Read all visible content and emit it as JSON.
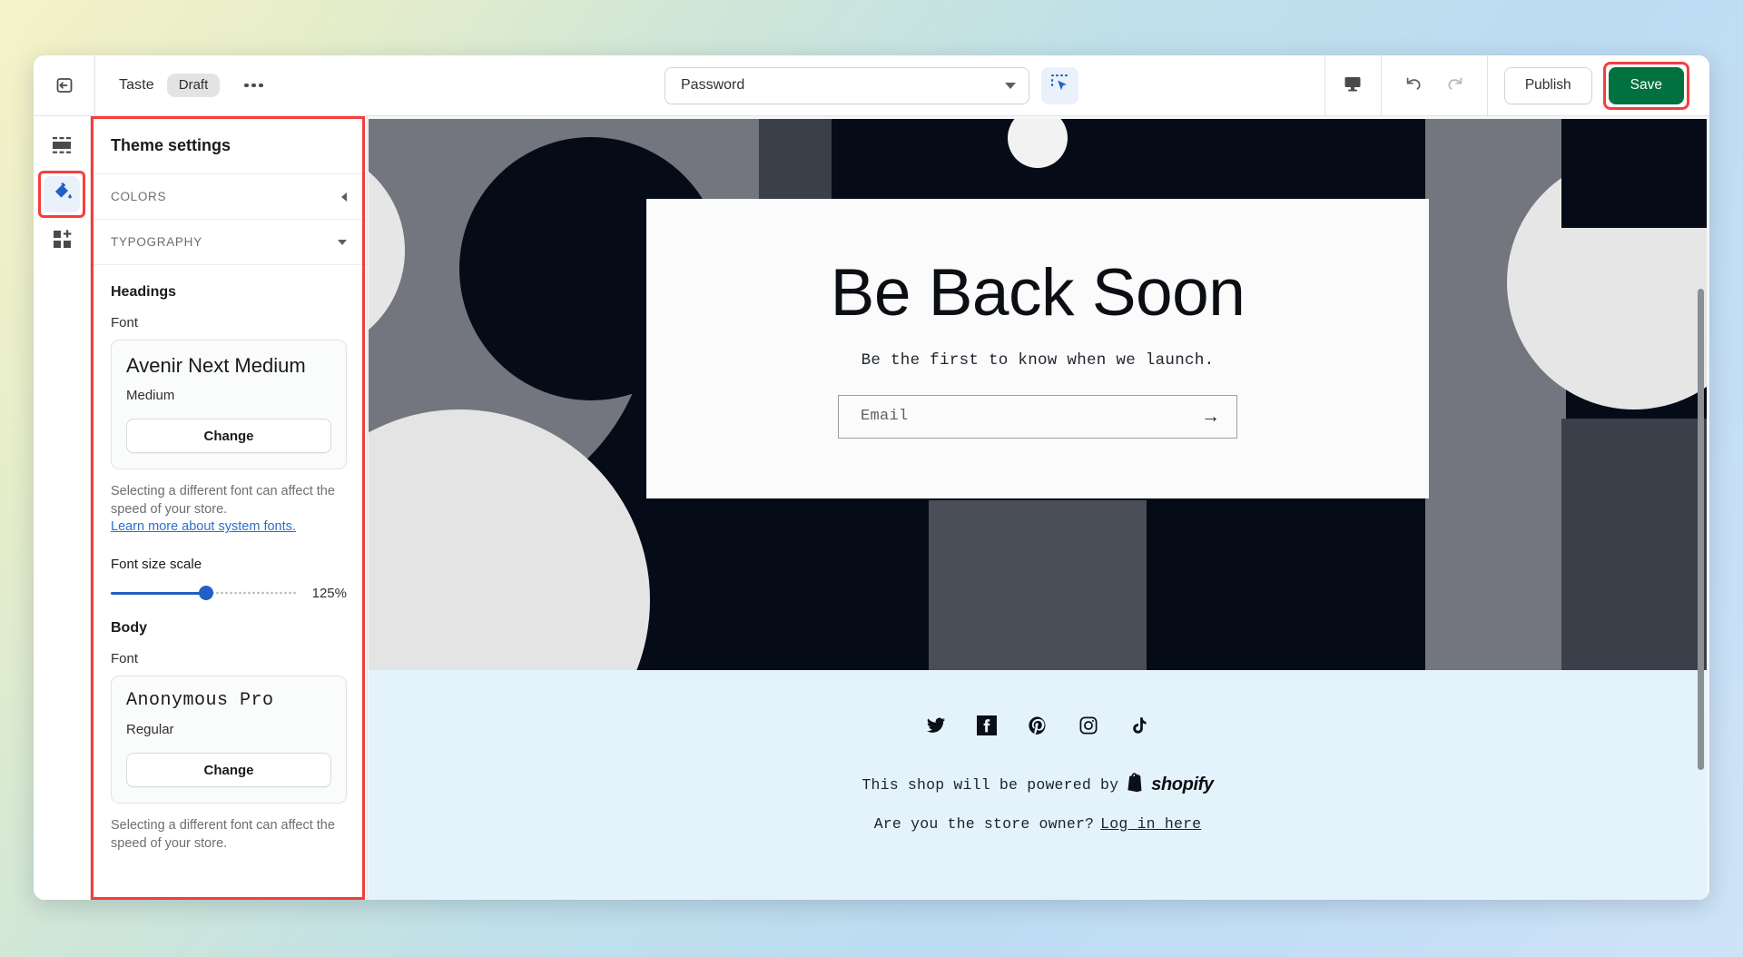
{
  "topbar": {
    "back_icon": "back-arrow-icon",
    "theme_name": "Taste",
    "status_badge": "Draft",
    "more_icon": "more-options-icon",
    "page_select_value": "Password",
    "inspect_icon": "select-inspect-icon",
    "device_icon": "desktop-preview-icon",
    "undo_icon": "undo-icon",
    "redo_icon": "redo-icon",
    "publish_label": "Publish",
    "save_label": "Save",
    "save_color": "#00713f",
    "highlight_color": "#f63d3d"
  },
  "rail": {
    "items": [
      {
        "name": "sections-icon",
        "label": "Sections"
      },
      {
        "name": "theme-settings-paint-icon",
        "label": "Theme settings"
      },
      {
        "name": "apps-icon",
        "label": "Apps"
      }
    ],
    "active_index": 1
  },
  "sidebar": {
    "title": "Theme settings",
    "sections": [
      {
        "name": "COLORS",
        "expanded": false,
        "chevron": "chevron-left-icon"
      },
      {
        "name": "TYPOGRAPHY",
        "expanded": true,
        "chevron": "chevron-down-icon"
      }
    ],
    "typography": {
      "headings": {
        "group_title": "Headings",
        "font_label": "Font",
        "font_name": "Avenir Next Medium",
        "font_weight": "Medium",
        "change_label": "Change",
        "help_text": "Selecting a different font can affect the speed of your store.",
        "help_link": "Learn more about system fonts.",
        "scale_label": "Font size scale",
        "scale_value": "125%",
        "scale_percent": 51
      },
      "body": {
        "group_title": "Body",
        "font_label": "Font",
        "font_name": "Anonymous Pro",
        "font_weight": "Regular",
        "change_label": "Change",
        "help_text": "Selecting a different font can affect the speed of your store."
      }
    }
  },
  "preview": {
    "hero": {
      "title": "Be Back Soon",
      "subtitle": "Be the first to know when we launch.",
      "email_placeholder": "Email",
      "submit_icon": "arrow-right-icon"
    },
    "footer": {
      "socials": [
        {
          "name": "twitter-icon"
        },
        {
          "name": "facebook-icon"
        },
        {
          "name": "pinterest-icon"
        },
        {
          "name": "instagram-icon"
        },
        {
          "name": "tiktok-icon"
        }
      ],
      "powered_by_text": "This shop will be powered by",
      "shopify_wordmark": "shopify",
      "owner_text": "Are you the store owner?",
      "login_link": "Log in here"
    }
  }
}
